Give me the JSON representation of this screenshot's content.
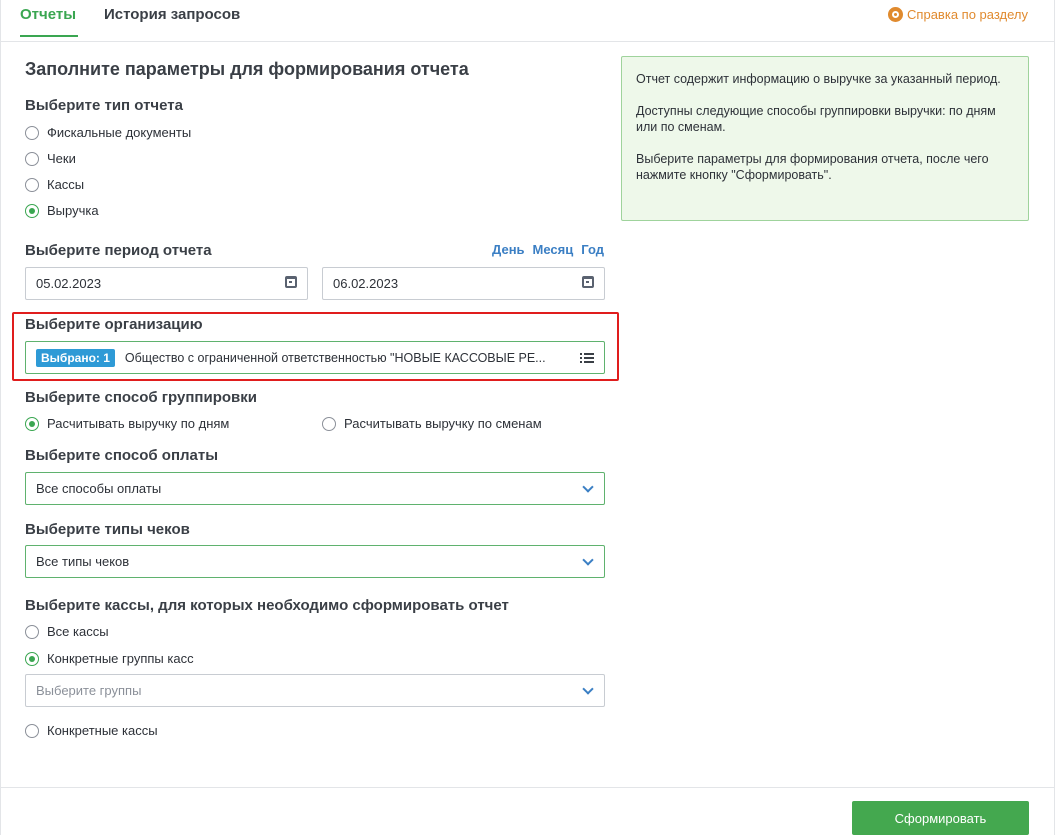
{
  "tabs": [
    {
      "label": "Отчеты",
      "active": true
    },
    {
      "label": "История запросов",
      "active": false
    }
  ],
  "help_link": "Справка по разделу",
  "page_title": "Заполните параметры для формирования отчета",
  "report_type": {
    "title": "Выберите тип отчета",
    "options": [
      "Фискальные документы",
      "Чеки",
      "Кассы",
      "Выручка"
    ],
    "selected": "Выручка"
  },
  "period": {
    "title": "Выберите период отчета",
    "links": [
      "День",
      "Месяц",
      "Год"
    ],
    "date_from": "05.02.2023",
    "date_to": "06.02.2023"
  },
  "organization": {
    "title": "Выберите организацию",
    "badge": "Выбрано: 1",
    "value": "Общество с ограниченной ответственностью \"НОВЫЕ КАССОВЫЕ РЕ..."
  },
  "grouping": {
    "title": "Выберите способ группировки",
    "options": [
      "Расчитывать выручку по дням",
      "Расчитывать выручку по сменам"
    ],
    "selected": "Расчитывать выручку по дням"
  },
  "payment": {
    "title": "Выберите способ оплаты",
    "value": "Все способы оплаты"
  },
  "receipt_types": {
    "title": "Выберите типы чеков",
    "value": "Все типы чеков"
  },
  "registers": {
    "title": "Выберите кассы, для которых необходимо сформировать отчет",
    "options": [
      "Все кассы",
      "Конкретные группы касс",
      "Конкретные кассы"
    ],
    "selected": "Конкретные группы касс",
    "groups_placeholder": "Выберите группы"
  },
  "info": {
    "p1": "Отчет содержит информацию о выручке за указанный период.",
    "p2": "Доступны следующие способы группировки выручки: по дням или по сменам.",
    "p3": "Выберите параметры для формирования отчета, после чего нажмите кнопку \"Сформировать\"."
  },
  "submit_label": "Сформировать",
  "colors": {
    "accent": "#3aa651",
    "link": "#3b7fc4",
    "help": "#e08a2e",
    "highlight": "#e01d1d",
    "badge": "#2e9ad6"
  }
}
